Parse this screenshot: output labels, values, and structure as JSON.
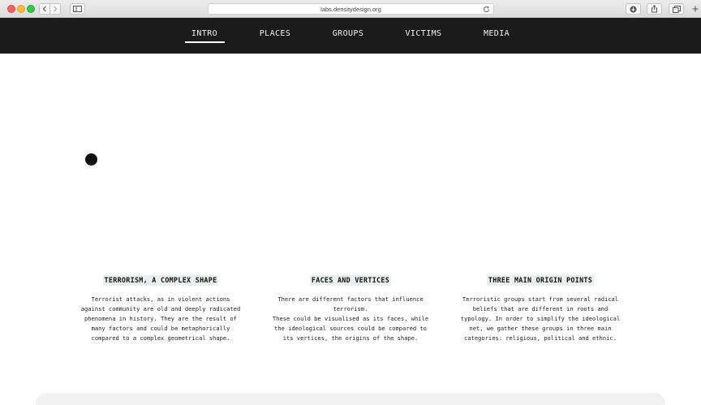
{
  "browser": {
    "url": "labs.densitydesign.org",
    "icons": {
      "back": "chevron-left-icon",
      "forward": "chevron-right-icon",
      "sidebar": "sidebar-icon",
      "reload": "reload-icon",
      "download": "download-icon",
      "share": "share-icon",
      "tabs": "tabs-icon",
      "new_tab": "plus-icon"
    }
  },
  "nav": {
    "items": [
      {
        "label": "INTRO",
        "active": true
      },
      {
        "label": "PLACES",
        "active": false
      },
      {
        "label": "GROUPS",
        "active": false
      },
      {
        "label": "VICTIMS",
        "active": false
      },
      {
        "label": "MEDIA",
        "active": false
      }
    ],
    "background": "#1b1b1b"
  },
  "sections": [
    {
      "title": "TERRORISM, A COMPLEX SHAPE",
      "text": "Terrorist attacks, as in violent actions\nagainst community are old and deeply radicated\nphenomena in history. They are the result of\nmany factors and could be metaphorically\ncompared to a complex geometrical shape."
    },
    {
      "title": "FACES AND VERTICES",
      "text": "There are different factors that influence\nterrorism.\nThese could be visualised as its faces, while\nthe ideological sources could be compared to\nits vertices, the origins of the shape."
    },
    {
      "title": "THREE MAIN ORIGIN POINTS",
      "text": "Terroristic groups start from several radical\nbeliefs that are different in roots and\ntypology. In order to simplify the ideological\nnet, we gather these groups in three main\ncategories: religious, political and ethnic."
    }
  ]
}
